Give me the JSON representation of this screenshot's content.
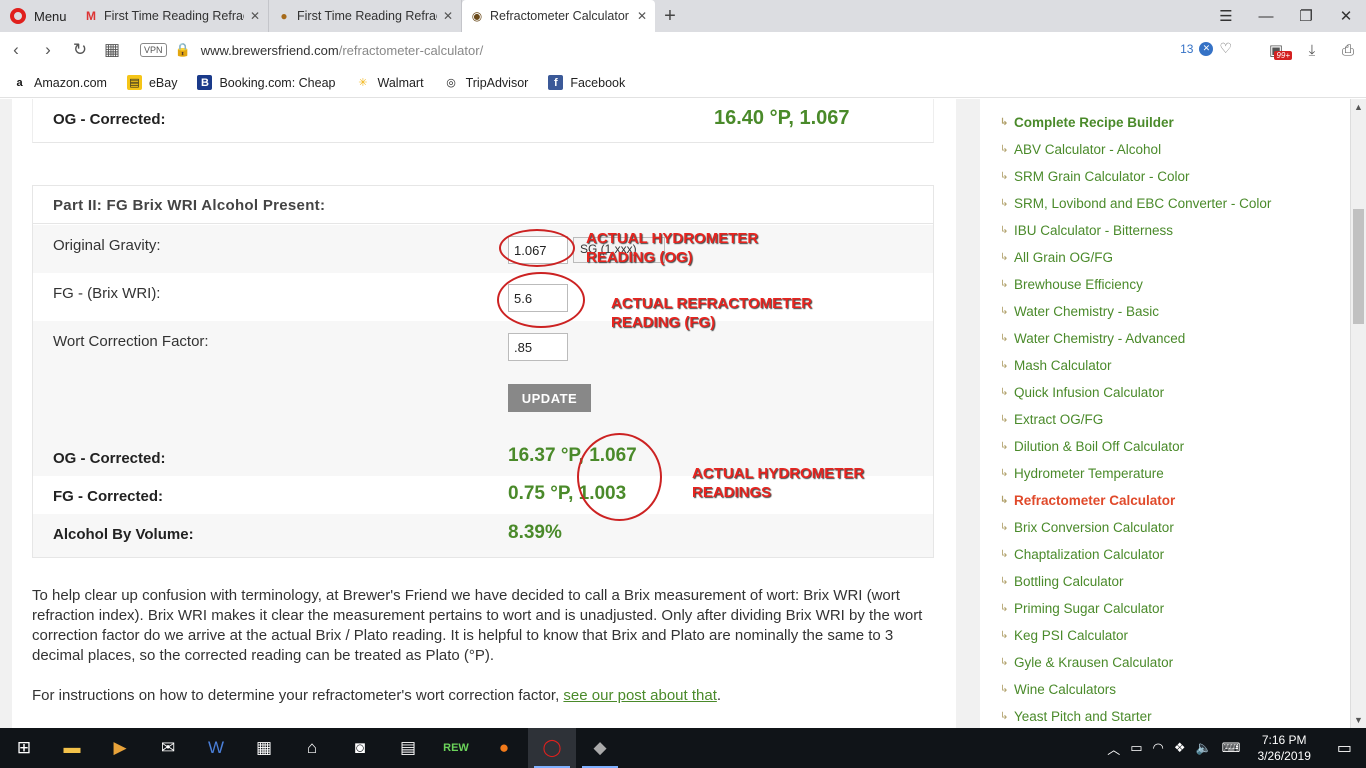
{
  "browser": {
    "menu_label": "Menu",
    "tabs": [
      {
        "title": "First Time Reading Refractor",
        "favicon": "gmail-icon"
      },
      {
        "title": "First Time Reading Refractor",
        "favicon": "forum-icon"
      },
      {
        "title": "Refractometer Calculator - B",
        "favicon": "brewersfriend-icon"
      }
    ],
    "url_host": "www.brewersfriend.com",
    "url_path": "/refractometer-calculator/",
    "vpn_label": "VPN",
    "adblock_count": "13",
    "ext_badge": "99+",
    "bookmarks": [
      {
        "label": "Amazon.com",
        "icon": "amazon-icon"
      },
      {
        "label": "eBay",
        "icon": "ebay-icon"
      },
      {
        "label": "Booking.com: Cheap",
        "icon": "booking-icon"
      },
      {
        "label": "Walmart",
        "icon": "walmart-icon"
      },
      {
        "label": "TripAdvisor",
        "icon": "tripadvisor-icon"
      },
      {
        "label": "Facebook",
        "icon": "facebook-icon"
      }
    ]
  },
  "part1": {
    "og_label": "OG - Corrected:",
    "og_value": "16.40 °P, 1.067"
  },
  "part2": {
    "title": "Part II: FG Brix WRI Alcohol Present:",
    "og_label": "Original Gravity:",
    "og_input": "1.067",
    "og_unit": "SG (1.xxx)",
    "fg_label": "FG - (Brix WRI):",
    "fg_input": "5.6",
    "wcf_label": "Wort Correction Factor:",
    "wcf_input": ".85",
    "update_label": "UPDATE",
    "results": {
      "og_label": "OG - Corrected:",
      "og_value": "16.37 °P, 1.067",
      "fg_label": "FG - Corrected:",
      "fg_value": "0.75 °P, 1.003",
      "abv_label": "Alcohol By Volume:",
      "abv_value": "8.39%"
    }
  },
  "annotations": {
    "a1": [
      "ACTUAL HYDROMETER",
      "READING (OG)"
    ],
    "a2": [
      "ACTUAL REFRACTOMETER",
      "READING (FG)"
    ],
    "a3": [
      "ACTUAL HYDROMETER",
      "READINGS"
    ]
  },
  "body_text": {
    "para1": "To help clear up confusion with terminology, at Brewer's Friend we have decided to call a Brix measurement of wort: Brix WRI (wort refraction index). Brix WRI makes it clear the measurement pertains to wort and is unadjusted. Only after dividing Brix WRI by the wort correction factor do we arrive at the actual Brix / Plato reading. It is helpful to know that Brix and Plato are nominally the same to 3 decimal places, so the corrected reading can be treated as Plato (°P).",
    "para2_prefix": "For instructions on how to determine your refractometer's wort correction factor, ",
    "para2_link": "see our post about that",
    "para2_suffix": "."
  },
  "sidebar": {
    "items": [
      "Complete Recipe Builder",
      "ABV Calculator - Alcohol",
      "SRM Grain Calculator - Color",
      "SRM, Lovibond and EBC Converter - Color",
      "IBU Calculator - Bitterness",
      "All Grain OG/FG",
      "Brewhouse Efficiency",
      "Water Chemistry - Basic",
      "Water Chemistry - Advanced",
      "Mash Calculator",
      "Quick Infusion Calculator",
      "Extract OG/FG",
      "Dilution & Boil Off Calculator",
      "Hydrometer Temperature",
      "Refractometer Calculator",
      "Brix Conversion Calculator",
      "Chaptalization Calculator",
      "Bottling Calculator",
      "Priming Sugar Calculator",
      "Keg PSI Calculator",
      "Gyle & Krausen Calculator",
      "Wine Calculators",
      "Yeast Pitch and Starter"
    ]
  },
  "taskbar": {
    "time": "7:16 PM",
    "date": "3/26/2019"
  },
  "colors": {
    "accent_green": "#4a8a2a",
    "annotation_red": "#e8241f",
    "current_link": "#e0492a"
  }
}
